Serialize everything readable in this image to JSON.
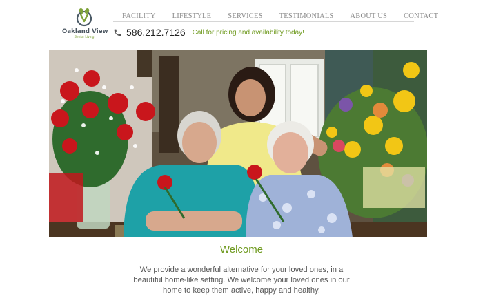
{
  "logo": {
    "name": "Oakland View",
    "tagline": "Senior Living",
    "colors": {
      "ring": "#4b5a66",
      "leaf": "#7fa33a"
    }
  },
  "nav": {
    "items": [
      "FACILITY",
      "LIFESTYLE",
      "SERVICES",
      "TESTIMONIALS",
      "ABOUT US",
      "CONTACT"
    ]
  },
  "contact": {
    "icon": "phone-icon",
    "phone": "586.212.7126",
    "cta": "Call for pricing and availability today!"
  },
  "hero": {
    "image": "photo-three-women-with-flowers"
  },
  "content": {
    "heading": "Welcome",
    "body": "We provide a wonderful alternative for your loved ones, in a beautiful home-like setting. We welcome your loved ones in our home to keep them active, happy and healthy."
  },
  "colors": {
    "accent": "#6f9a1f",
    "nav_text": "#8d8d8d",
    "nav_border": "#d6d6d6"
  }
}
